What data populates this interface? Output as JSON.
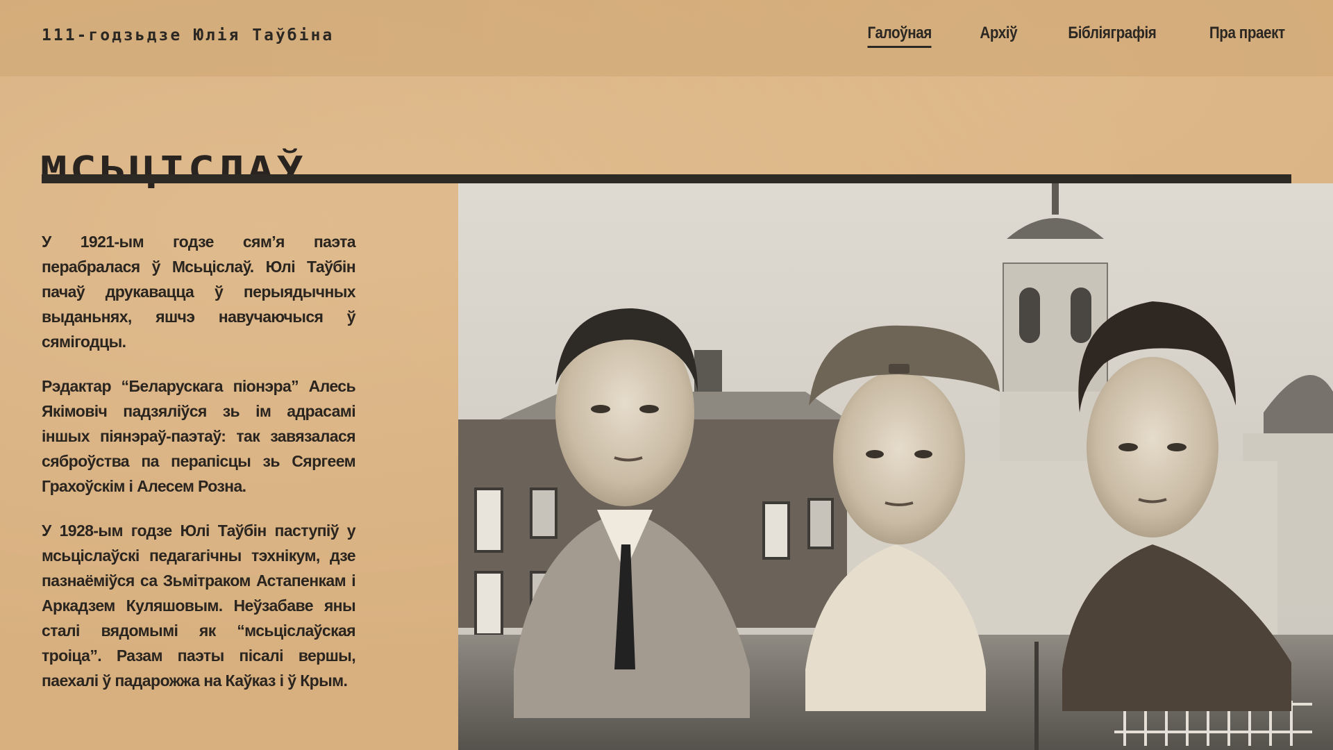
{
  "header": {
    "site_title": "111-годзьдзе Юлія Таўбіна",
    "nav": [
      {
        "label": "Галоўная",
        "active": true
      },
      {
        "label": "Архіў",
        "active": false
      },
      {
        "label": "Бібліяграфія",
        "active": false
      },
      {
        "label": "Пра праект",
        "active": false
      }
    ]
  },
  "main": {
    "title": "МСЬЦІСЛАЎ",
    "paragraphs": [
      "У 1921-ым годзе сям’я паэта перабралася ў Мсьціслаў. Юлі Таўбін пачаў друкавацца ў перыядычных выданьнях, яшчэ навучаючыся ў сямігодцы.",
      "Рэдактар “Беларускага піонэра” Алесь Якімовіч падзяліўся зь ім адрасамі іншых піянэраў-паэтаў: так завязалася сяброўства па перапісцы зь Сяргеем Грахоўскім і Алесем Розна.",
      "У 1928-ым годзе Юлі Таўбін паступіў у мсьціслаўскі педагагічны тэхнікум, дзе пазнаёміўся са Зьмітраком Астапенкам і Аркадзем Куляшовым. Неўзабаве яны сталі вядомымі як “мсьціслаўская троіца”. Разам паэты пісалі вершы, паехалі ў падарожжа на Каўказ і ў Крым."
    ]
  },
  "colors": {
    "background": "#d8b080",
    "text": "#2b2520",
    "rule": "#2d2a26"
  }
}
